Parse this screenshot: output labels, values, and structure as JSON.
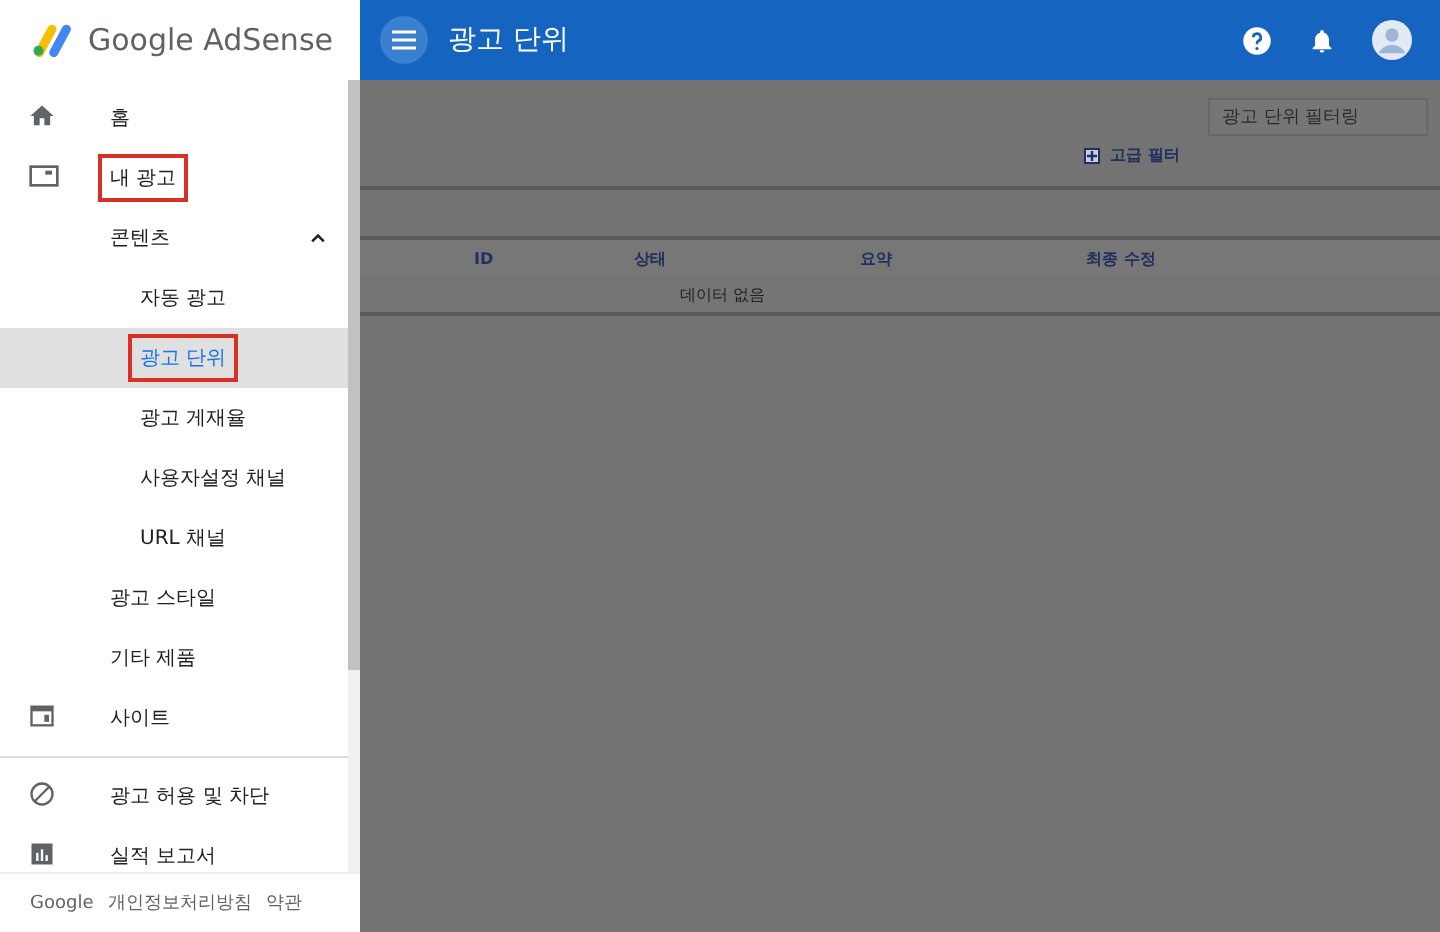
{
  "brand": {
    "name": "Google AdSense"
  },
  "top_bar": {
    "title": "광고 단위"
  },
  "filter": {
    "placeholder": "광고 단위 필터링"
  },
  "advanced_filter": {
    "label": "고급 필터"
  },
  "table": {
    "columns": [
      "ID",
      "상태",
      "요약",
      "최종 수정"
    ],
    "empty_message": "데이터 없음"
  },
  "nav": {
    "sections": [
      [
        {
          "label": "홈",
          "selected": false,
          "highlighted": false
        },
        {
          "label": "내 광고",
          "selected": false,
          "highlighted": true,
          "children": [
            {
              "label": "콘텐츠",
              "selected": false,
              "highlighted": false,
              "expanded": true,
              "children": [
                {
                  "label": "자동 광고",
                  "selected": false,
                  "highlighted": false
                },
                {
                  "label": "광고 단위",
                  "selected": true,
                  "highlighted": true
                },
                {
                  "label": "광고 게재율",
                  "selected": false,
                  "highlighted": false
                },
                {
                  "label": "사용자설정 채널",
                  "selected": false,
                  "highlighted": false
                },
                {
                  "label": "URL 채널",
                  "selected": false,
                  "highlighted": false
                }
              ]
            },
            {
              "label": "광고 스타일",
              "selected": false,
              "highlighted": false
            },
            {
              "label": "기타 제품",
              "selected": false,
              "highlighted": false
            }
          ]
        },
        {
          "label": "사이트",
          "selected": false,
          "highlighted": false
        }
      ],
      [
        {
          "label": "광고 허용 및 차단",
          "selected": false,
          "highlighted": false
        },
        {
          "label": "실적 보고서",
          "selected": false,
          "highlighted": false
        }
      ]
    ]
  },
  "footer": {
    "links": [
      "Google",
      "개인정보처리방침",
      "약관"
    ]
  }
}
